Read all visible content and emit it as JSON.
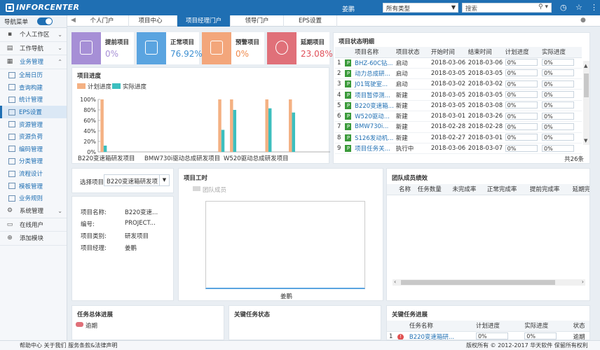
{
  "header": {
    "logo": "INFORCENTER",
    "user": "姜鹏",
    "type_select": "所有类型",
    "search_placeholder": "搜索"
  },
  "sidebar": {
    "nav_label": "导航菜单",
    "items": [
      {
        "label": "个人工作区",
        "icon": "person-icon"
      },
      {
        "label": "工作导航",
        "icon": "folder-icon"
      },
      {
        "label": "业务管理",
        "icon": "briefcase-icon"
      }
    ],
    "sub_items": [
      "全局日历",
      "查询构建",
      "统计管理",
      "EPS设置",
      "资源管理",
      "资源负荷",
      "编码管理",
      "分类管理",
      "流程设计",
      "模板管理",
      "业务规则"
    ],
    "bottom_items": [
      {
        "label": "系统管理",
        "icon": "gear-icon"
      },
      {
        "label": "在线用户",
        "icon": "monitor-icon"
      },
      {
        "label": "添加模块",
        "icon": "plus-circle-icon"
      }
    ]
  },
  "tabs": [
    "个人门户",
    "项目中心",
    "项目经理门户",
    "领导门户",
    "EPS设置"
  ],
  "stats": [
    {
      "title": "提前项目",
      "value": "0%",
      "color": "#a68fd6",
      "text_color": "#a68fd6"
    },
    {
      "title": "正常项目",
      "value": "76.92%",
      "color": "#5aa4e0",
      "text_color": "#3d8fd1"
    },
    {
      "title": "预警项目",
      "value": "0%",
      "color": "#f3a67b",
      "text_color": "#f08a4c"
    },
    {
      "title": "延期项目",
      "value": "23.08%",
      "color": "#e07079",
      "text_color": "#e0505a"
    }
  ],
  "progress_chart": {
    "title": "项目进度",
    "chart_data": {
      "type": "bar",
      "series": [
        {
          "name": "计划进度",
          "color": "#f4b183",
          "values": [
            100,
            0,
            0,
            0,
            0,
            0,
            0,
            0,
            0,
            0,
            100,
            100,
            0,
            0,
            100,
            0,
            100,
            0,
            0,
            0,
            0,
            0,
            0,
            0
          ]
        },
        {
          "name": "实际进度",
          "color": "#3cbfbf",
          "values": [
            12,
            0,
            0,
            0,
            0,
            0,
            0,
            0,
            0,
            0,
            42,
            80,
            0,
            0,
            83,
            0,
            75,
            0,
            0,
            0,
            3,
            0,
            20,
            0
          ]
        }
      ],
      "x_labels": [
        "B220变速箱研发项目",
        "BMW730i驱动总成研发项目",
        "W520驱动总成研发项目"
      ],
      "y_ticks": [
        "100%",
        "80%",
        "60%",
        "40%",
        "20%",
        "0%"
      ],
      "ylim": [
        0,
        100
      ]
    }
  },
  "status_table": {
    "title": "项目状态明细",
    "columns": [
      "项目名称",
      "项目状态",
      "开始时间",
      "结束时间",
      "计划进度",
      "实际进度"
    ],
    "rows": [
      {
        "n": "1",
        "name": "BHZ-60C钻...",
        "status": "启动",
        "start": "2018-03-06",
        "end": "2018-03-06",
        "plan": "0%",
        "actual": "0%"
      },
      {
        "n": "2",
        "name": "动力总成研...",
        "status": "启动",
        "start": "2018-03-05",
        "end": "2018-03-05",
        "plan": "0%",
        "actual": "0%"
      },
      {
        "n": "3",
        "name": "J01驾驶室...",
        "status": "启动",
        "start": "2018-03-02",
        "end": "2018-03-02",
        "plan": "0%",
        "actual": "0%"
      },
      {
        "n": "4",
        "name": "项目暂停测...",
        "status": "新建",
        "start": "2018-03-05",
        "end": "2018-03-05",
        "plan": "0%",
        "actual": "0%"
      },
      {
        "n": "5",
        "name": "B220变速箱...",
        "status": "新建",
        "start": "2018-03-05",
        "end": "2018-03-08",
        "plan": "0%",
        "actual": "0%"
      },
      {
        "n": "6",
        "name": "W520驱动...",
        "status": "新建",
        "start": "2018-03-01",
        "end": "2018-03-26",
        "plan": "0%",
        "actual": "0%"
      },
      {
        "n": "7",
        "name": "BMW730i...",
        "status": "新建",
        "start": "2018-02-28",
        "end": "2018-02-28",
        "plan": "0%",
        "actual": "0%"
      },
      {
        "n": "8",
        "name": "S126发动机...",
        "status": "新建",
        "start": "2018-02-27",
        "end": "2018-03-01",
        "plan": "0%",
        "actual": "0%"
      },
      {
        "n": "9",
        "name": "项目任务关...",
        "status": "执行中",
        "start": "2018-03-06",
        "end": "2018-03-07",
        "plan": "0%",
        "actual": "0%"
      }
    ],
    "total": "共26条"
  },
  "select_project": {
    "label": "选择项目",
    "value": "B220变速箱研发项"
  },
  "project_info": {
    "rows": [
      {
        "k": "项目名称:",
        "v": "B220变速..."
      },
      {
        "k": "编号:",
        "v": "PROJECT..."
      },
      {
        "k": "项目类别:",
        "v": "研发项目"
      },
      {
        "k": "项目经理:",
        "v": "姜鹏"
      }
    ]
  },
  "work_hours": {
    "title": "项目工时",
    "legend": "团队成员",
    "x_label": "姜鹏"
  },
  "team_perf": {
    "title": "团队成员绩效",
    "columns": [
      "名称",
      "任务数量",
      "未完成率",
      "正常完成率",
      "提前完成率",
      "延期完"
    ]
  },
  "overall_progress": {
    "title": "任务总体进展",
    "legend": "逾期"
  },
  "key_status": {
    "title": "关键任务状态"
  },
  "key_progress": {
    "title": "关键任务进展",
    "columns": [
      "任务名称",
      "计划进度",
      "实际进度",
      "状态"
    ],
    "rows": [
      {
        "n": "1",
        "name": "B220变速箱研...",
        "plan": "0%",
        "actual": "0%",
        "status": "逾期"
      }
    ]
  },
  "footer": {
    "links": "帮助中心  关于我们  服务条款&法律声明",
    "copyright": "版权所有 © 2012-2017  华天软件  保留所有权利"
  }
}
